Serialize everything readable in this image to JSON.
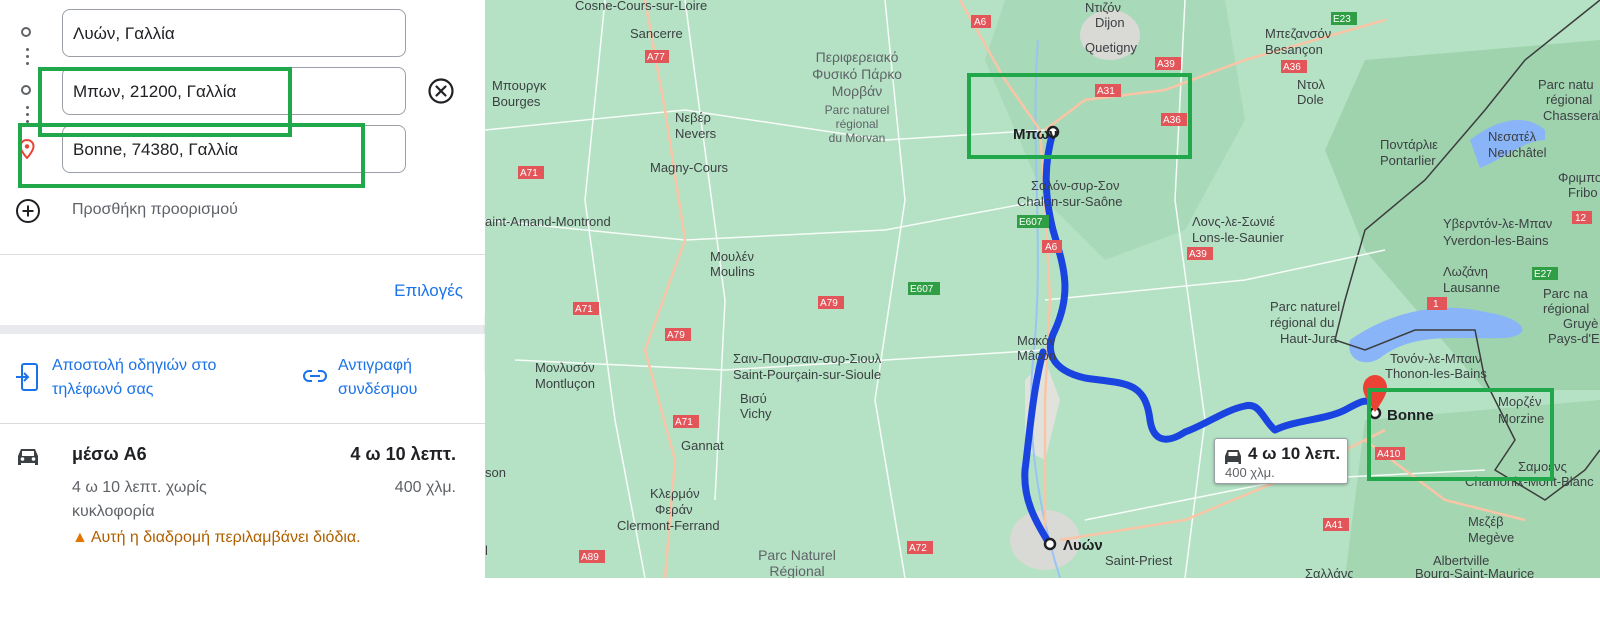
{
  "directions": {
    "stops": [
      {
        "value": "Λυών, Γαλλία"
      },
      {
        "value": "Μπων, 21200, Γαλλία"
      },
      {
        "value": "Bonne, 74380, Γαλλία"
      }
    ],
    "add_destination_label": "Προσθήκη προορισμού",
    "options_label": "Επιλογές"
  },
  "share": {
    "send_to_phone": "Αποστολή οδηγιών στο τηλέφωνό σας",
    "copy_link": "Αντιγραφή συνδέσμου"
  },
  "route": {
    "name": "μέσω A6",
    "duration": "4 ω 10 λεπτ.",
    "subtitle": "4 ω 10 λεπτ. χωρίς κυκλοφορία",
    "distance": "400 χλμ.",
    "warning": "Αυτή η διαδρομή περιλαμβάνει διόδια."
  },
  "map": {
    "tooltip_time": "4 ω 10 λεπ.",
    "tooltip_distance": "400 χλμ.",
    "labels": {
      "cosne": "Cosne-Cours-sur-Loire",
      "ntizon": "Ντιζόν",
      "dijon": "Dijon",
      "quetigny": "Quetigny",
      "besancon_gr": "Μπεζανσόν",
      "besancon": "Besançon",
      "sancerre": "Sancerre",
      "park_gr1": "Περιφερειακό",
      "park_gr2": "Φυσικό Πάρκο",
      "park_gr3": "Μορβάν",
      "park_fr1": "Parc naturel",
      "park_fr2": "régional",
      "park_fr3": "du Morvan",
      "ntol": "Ντολ",
      "dole": "Dole",
      "bourges_gr": "Μπουργκ",
      "bourges": "Bourges",
      "nevers_gr": "Νεβέρ",
      "nevers": "Nevers",
      "beaune": "Μπων",
      "pontarlier_gr": "Ποντάρλιε",
      "pontarlier": "Pontarlier",
      "neuchatel_gr": "Νεσατέλ",
      "neuchatel": "Neuchâtel",
      "magny": "Magny-Cours",
      "chalon_gr": "Σαλόν-συρ-Σον",
      "chalon": "Chalon-sur-Saône",
      "amand": "aint-Amand-Montrond",
      "lons_gr": "Λονς-λε-Σωνιέ",
      "lons": "Lons-le-Saunier",
      "yverdon_gr": "Υβερντόν-λε-Μπαν",
      "yverdon": "Yverdon-les-Bains",
      "moulins_gr": "Μουλέν",
      "moulins": "Moulins",
      "lausanne_gr": "Λωζάνη",
      "lausanne": "Lausanne",
      "jura1": "Parc naturel",
      "jura2": "régional du",
      "jura3": "Haut-Jura",
      "macon_gr": "Μακόν",
      "macon": "Mâcon",
      "montlucon_gr": "Μονλυσόν",
      "montlucon": "Montluçon",
      "pourcain_gr": "Σαιν-Πουρσαιν-συρ-Σιουλ",
      "pourcain": "Saint-Pourçain-sur-Sioule",
      "vichy_gr": "Βισύ",
      "vichy": "Vichy",
      "thonon_gr": "Τονόν-λε-Μπαιν",
      "thonon": "Thonon-les-Bains",
      "bonne": "Bonne",
      "morzine_gr": "Μορζέν",
      "morzine": "Morzine",
      "gannat": "Gannat",
      "son": "son",
      "samoens": "Σαμοένς",
      "chamonix": "Chamonix-Mont-Blanc",
      "clermont_gr1": "Κλερμόν",
      "clermont_gr2": "Φεράν",
      "clermont": "Clermont-Ferrand",
      "megeve_gr": "Μεζέβ",
      "megeve": "Megève",
      "lyon": "Λυών",
      "priest": "Saint-Priest",
      "pnr1": "Parc Naturel",
      "pnr2": "Régional",
      "albertville": "Albertville",
      "chasseral1": "Parc natu",
      "chasseral2": "régional",
      "chasseral3": "Chasseral",
      "fribo1": "Φριμπο",
      "fribo2": "Fribo",
      "gruyere1": "Parc na",
      "gruyere2": "régional",
      "gruyere3": "Gruyè",
      "gruyere4": "Pays-d'E",
      "bourg": "Bourg-Saint-Maurice",
      "sallanches": "Σαλλάνς",
      "l": "l"
    },
    "road_shields": {
      "a6_top": "A6",
      "a77": "A77",
      "e23": "E23",
      "a39_top": "A39",
      "a36_top": "A36",
      "a31": "A31",
      "a36": "A36",
      "a71_top": "A71",
      "e607_top": "E607",
      "a6": "A6",
      "a39": "A39",
      "e607": "E607",
      "a79": "A79",
      "a71_mid": "A71",
      "a79_b": "A79",
      "e27": "E27",
      "n1": "1",
      "n12": "12",
      "a410": "A410",
      "a71_low": "A71",
      "a41": "A41",
      "a72": "A72",
      "a89": "A89"
    }
  }
}
